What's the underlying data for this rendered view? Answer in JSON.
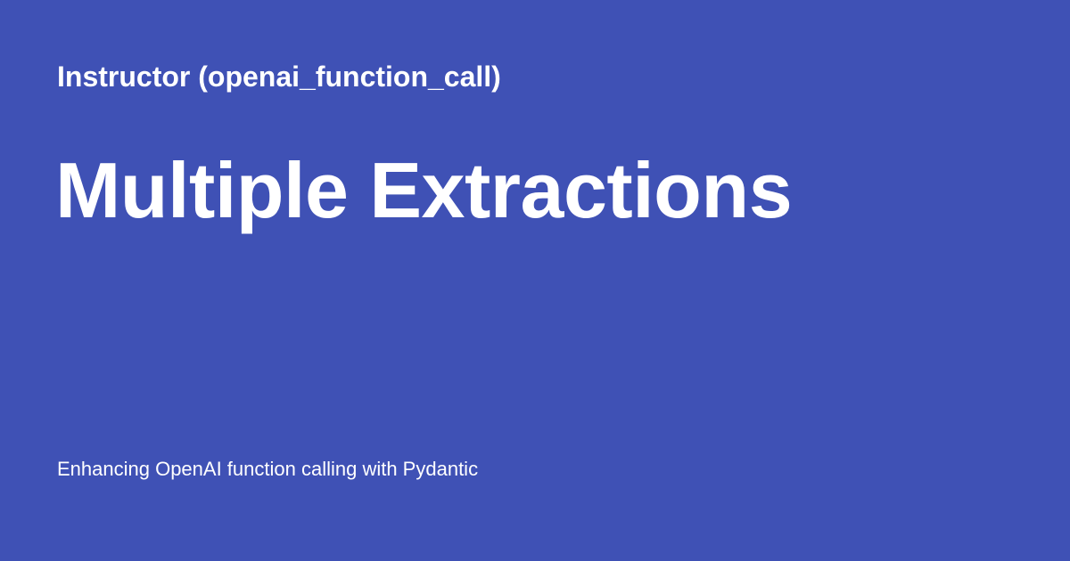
{
  "card": {
    "site_name": "Instructor (openai_function_call)",
    "title": "Multiple Extractions",
    "description": "Enhancing OpenAI function calling with Pydantic",
    "background_color": "#3f51b5",
    "text_color": "#ffffff"
  }
}
